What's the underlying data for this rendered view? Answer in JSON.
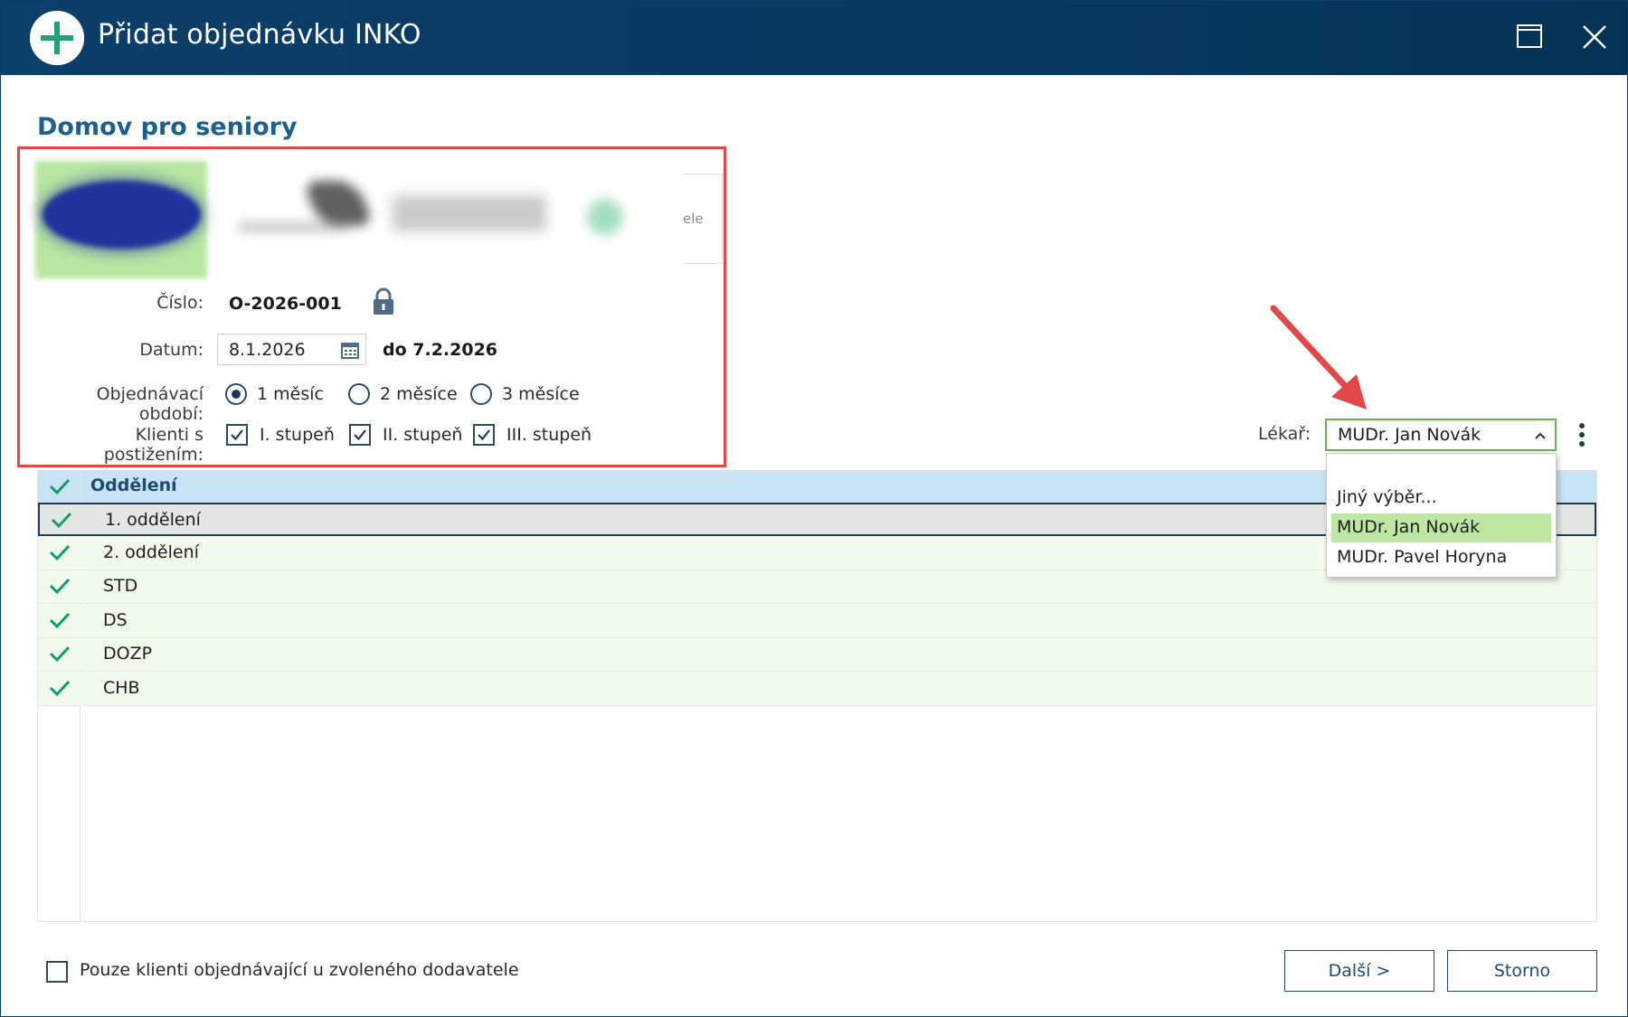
{
  "window": {
    "title": "Přidat objednávku INKO",
    "maximize_icon": "maximize-icon",
    "close_icon": "close-icon",
    "app_icon": "plus-circle-icon",
    "accent": "#0c3f6a"
  },
  "section_title": "Domov pro seniory",
  "logo_strip": {
    "partial_text": "ele"
  },
  "form": {
    "cislo_label": "Číslo:",
    "cislo_value": "O-2026-001",
    "lock_icon": "lock-icon",
    "datum_label": "Datum:",
    "datum_value": "8.1.2026",
    "datum_to": "do 7.2.2026",
    "calendar_icon": "calendar-icon",
    "period_label": "Objednávací období:",
    "period_options": [
      "1 měsíc",
      "2 měsíce",
      "3 měsíce"
    ],
    "period_selected": "1 měsíc",
    "disability_label": "Klienti s postižením:",
    "disability_options": [
      "I. stupeň",
      "II. stupeň",
      "III. stupeň"
    ],
    "disability_checked": [
      true,
      true,
      true
    ]
  },
  "doctor": {
    "label": "Lékař:",
    "selected": "MUDr. Jan Novák",
    "options": [
      "Jiný výběr...",
      "MUDr. Jan Novák",
      "MUDr. Pavel Horyna"
    ],
    "highlight_color": "#bde6a3"
  },
  "grid": {
    "header": "Oddělení",
    "rows": [
      "1. oddělení",
      "2. oddělení",
      "STD",
      "DS",
      "DOZP",
      "CHB"
    ],
    "selected_row": "1. oddělení",
    "header_color": "#c8e3f3",
    "row_color": "#f1faec"
  },
  "footer": {
    "only_clients_label": "Pouze klienti objednávající u zvoleného dodavatele",
    "only_clients_checked": false,
    "next_button": "Další >",
    "cancel_button": "Storno"
  },
  "annotation": {
    "highlight_color": "#e24848"
  }
}
